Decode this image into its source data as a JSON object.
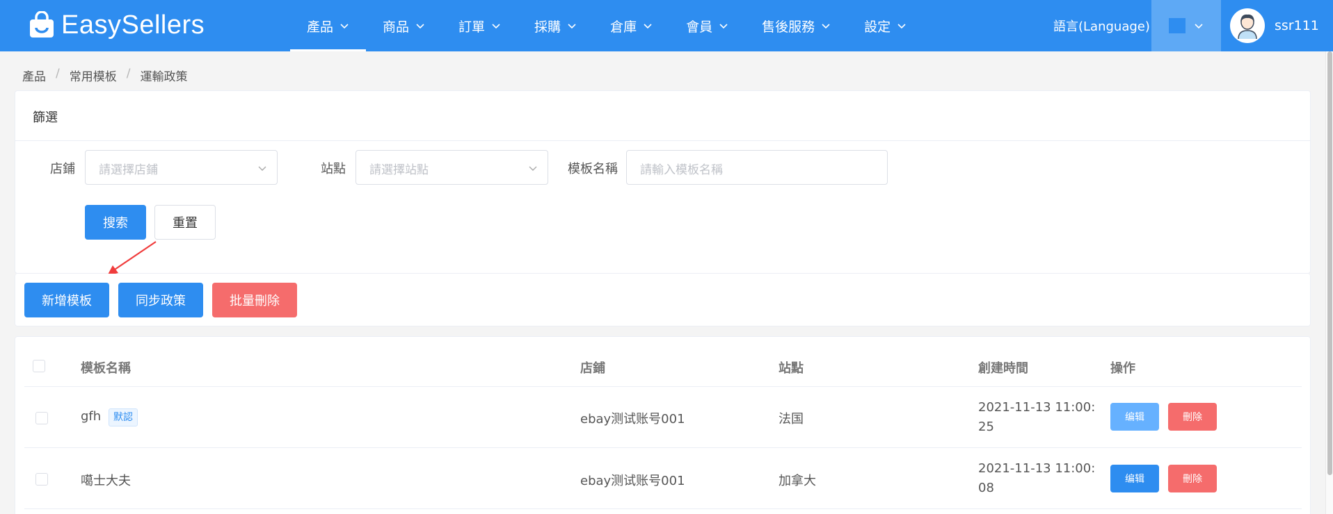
{
  "app": {
    "name": "EasySellers"
  },
  "nav": [
    {
      "label": "產品",
      "active": true
    },
    {
      "label": "商品"
    },
    {
      "label": "訂單"
    },
    {
      "label": "採購"
    },
    {
      "label": "倉庫"
    },
    {
      "label": "會員"
    },
    {
      "label": "售後服務"
    },
    {
      "label": "設定"
    }
  ],
  "header": {
    "language": "語言(Language)",
    "username": "ssr111",
    "theme_color": "#2e8df0"
  },
  "breadcrumb": [
    "產品",
    "常用模板",
    "運輸政策"
  ],
  "filter": {
    "title": "篩選",
    "shop_label": "店鋪",
    "shop_placeholder": "請選擇店鋪",
    "site_label": "站點",
    "site_placeholder": "請選擇站點",
    "template_label": "模板名稱",
    "template_placeholder": "請輸入模板名稱",
    "search_button": "搜索",
    "reset_button": "重置"
  },
  "actions": {
    "add": "新增模板",
    "sync": "同步政策",
    "batch_delete": "批量刪除"
  },
  "table": {
    "headers": {
      "name": "模板名稱",
      "shop": "店鋪",
      "site": "站點",
      "created": "創建時間",
      "ops": "操作"
    },
    "rows": [
      {
        "name": "gfh",
        "tag": "默認",
        "shop": "ebay测试账号001",
        "site": "法国",
        "created": "2021-11-13 11:00:25",
        "edit": "编辑",
        "delete": "刪除"
      },
      {
        "name": "噶士大夫",
        "tag": "",
        "shop": "ebay测试账号001",
        "site": "加拿大",
        "created": "2021-11-13 11:00:08",
        "edit": "编辑",
        "delete": "刪除"
      }
    ]
  },
  "colors": {
    "primary": "#2e8df0",
    "danger": "#f56c6c",
    "edit_light": "#66b1ff"
  }
}
